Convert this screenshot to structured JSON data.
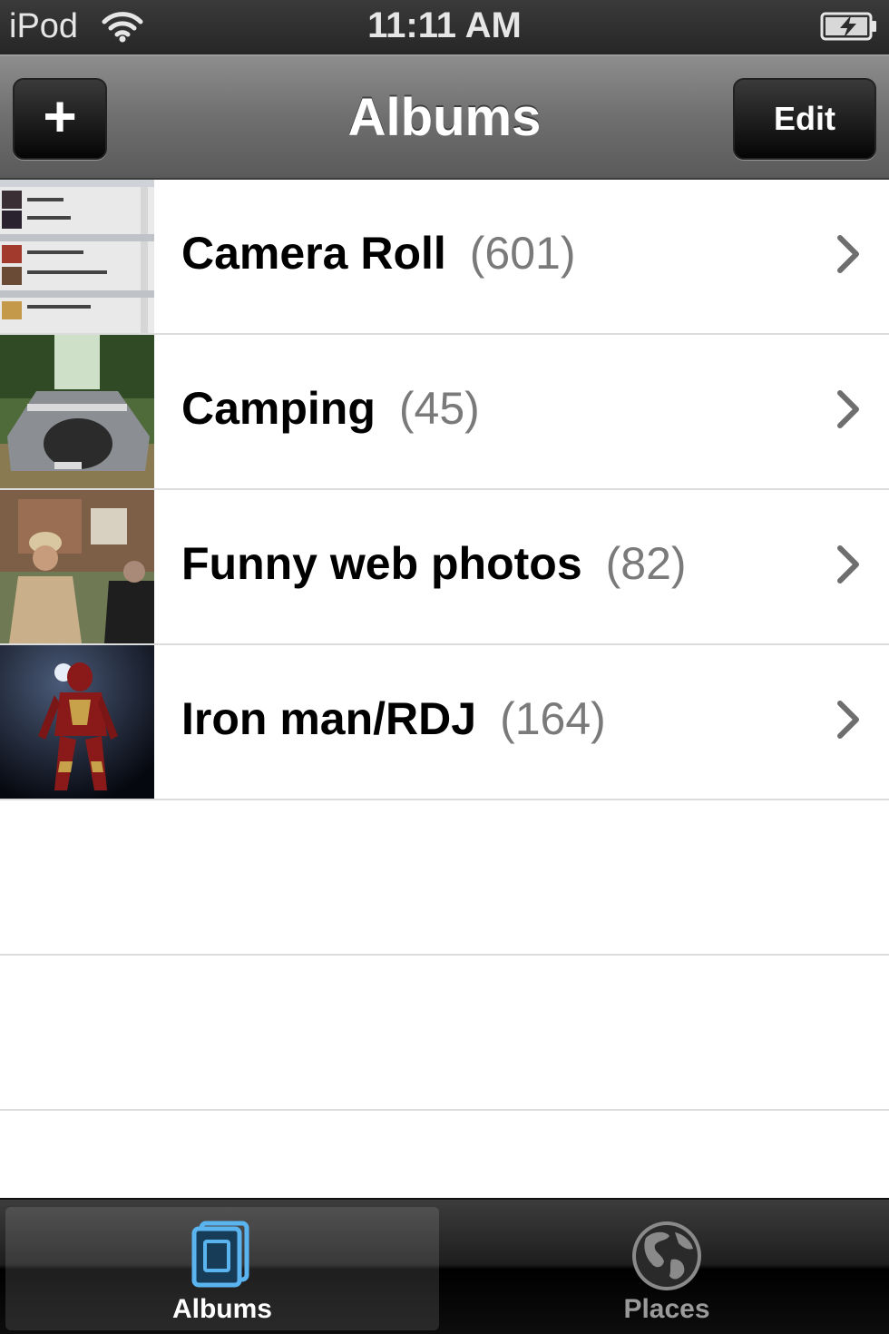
{
  "status_bar": {
    "carrier": "iPod",
    "time": "11:11 AM",
    "icons": [
      "wifi-icon",
      "battery-charging-icon"
    ]
  },
  "nav_bar": {
    "title": "Albums",
    "add_label": "+",
    "edit_label": "Edit"
  },
  "albums": [
    {
      "name": "Camera Roll",
      "count": "(601)",
      "thumb": "camera-roll-thumbnail"
    },
    {
      "name": "Camping",
      "count": "(45)",
      "thumb": "camping-tent-thumbnail"
    },
    {
      "name": "Funny web photos",
      "count": "(82)",
      "thumb": "funny-photo-thumbnail"
    },
    {
      "name": "Iron man/RDJ",
      "count": "(164)",
      "thumb": "iron-man-thumbnail"
    }
  ],
  "tab_bar": {
    "tabs": [
      {
        "label": "Albums",
        "icon": "albums-icon",
        "selected": true
      },
      {
        "label": "Places",
        "icon": "globe-icon",
        "selected": false
      }
    ]
  },
  "colors": {
    "accent_tab": "#5ab4f0",
    "count_gray": "#7a7a7a",
    "separator": "#dcdcdc"
  }
}
